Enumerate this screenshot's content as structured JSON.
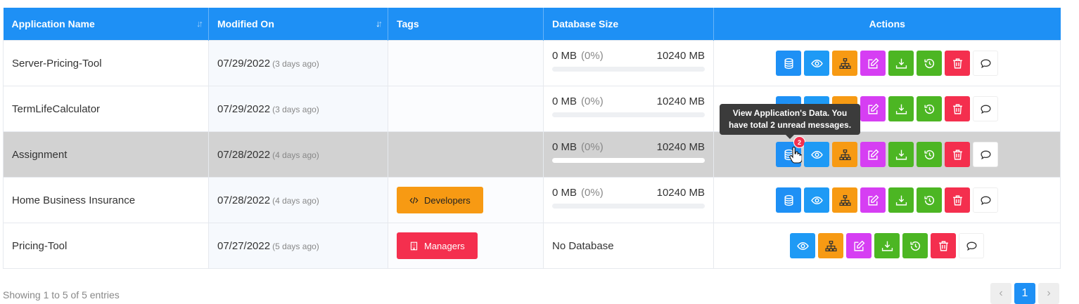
{
  "table": {
    "headers": [
      "Application Name",
      "Modified On",
      "Tags",
      "Database Size",
      "Actions"
    ],
    "rows": [
      {
        "name": "Server-Pricing-Tool",
        "date": "07/29/2022",
        "ago": "(3 days ago)",
        "tag": "",
        "db_used": "0 MB",
        "db_pct": "(0%)",
        "db_total": "10240 MB",
        "has_db": true,
        "db_percent_value": 0
      },
      {
        "name": "TermLifeCalculator",
        "date": "07/29/2022",
        "ago": "(3 days ago)",
        "tag": "",
        "db_used": "0 MB",
        "db_pct": "(0%)",
        "db_total": "10240 MB",
        "has_db": true,
        "db_percent_value": 0
      },
      {
        "name": "Assignment",
        "date": "07/28/2022",
        "ago": "(4 days ago)",
        "tag": "",
        "db_used": "0 MB",
        "db_pct": "(0%)",
        "db_total": "10240 MB",
        "has_db": true,
        "db_percent_value": 0,
        "highlighted": true,
        "unread_badge": "2"
      },
      {
        "name": "Home Business Insurance",
        "date": "07/28/2022",
        "ago": "(4 days ago)",
        "tag": "Developers",
        "db_used": "0 MB",
        "db_pct": "(0%)",
        "db_total": "10240 MB",
        "has_db": true,
        "db_percent_value": 0
      },
      {
        "name": "Pricing-Tool",
        "date": "07/27/2022",
        "ago": "(5 days ago)",
        "tag": "Managers",
        "db_text": "No Database",
        "has_db": false
      }
    ]
  },
  "tooltip": {
    "text": "View Application's Data. You have total 2 unread messages."
  },
  "footer": {
    "showing": "Showing 1 to 5 of 5 entries"
  },
  "pagination": {
    "prev": "‹",
    "current": "1",
    "next": "›"
  },
  "icons": {
    "actions": [
      "database-icon",
      "eye-icon",
      "sitemap-icon",
      "edit-icon",
      "download-icon",
      "history-icon",
      "trash-icon",
      "comment-icon"
    ],
    "tags": {
      "Developers": "code-icon",
      "Managers": "building-icon"
    }
  },
  "colors": {
    "header": "#1e90f5",
    "database": "#1e90f5",
    "view": "#1e9af5",
    "structure": "#f79a13",
    "edit": "#d63ef3",
    "download": "#4cb623",
    "history": "#4cb623",
    "delete": "#f42f4e"
  }
}
